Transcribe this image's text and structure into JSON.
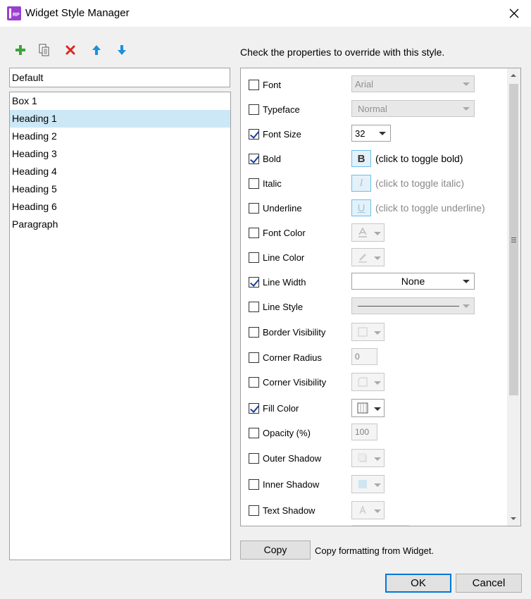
{
  "window": {
    "title": "Widget Style Manager",
    "app_icon_text": "RP"
  },
  "toolbar": {
    "add_icon": "plus-icon",
    "duplicate_icon": "duplicate-icon",
    "delete_icon": "delete-icon",
    "move_up_icon": "arrow-up-icon",
    "move_down_icon": "arrow-down-icon"
  },
  "style_name": "Default",
  "styles": [
    "Box 1",
    "Heading 1",
    "Heading 2",
    "Heading 3",
    "Heading 4",
    "Heading 5",
    "Heading 6",
    "Paragraph"
  ],
  "selected_style": "Heading 1",
  "instructions": "Check the properties to override with this style.",
  "properties": {
    "font": {
      "label": "Font",
      "checked": false,
      "value": "Arial"
    },
    "typeface": {
      "label": "Typeface",
      "checked": false,
      "value": "Normal"
    },
    "font_size": {
      "label": "Font Size",
      "checked": true,
      "value": "32"
    },
    "bold": {
      "label": "Bold",
      "checked": true,
      "glyph": "B",
      "hint": "(click to toggle bold)"
    },
    "italic": {
      "label": "Italic",
      "checked": false,
      "glyph": "I",
      "hint": "(click to toggle italic)"
    },
    "underline": {
      "label": "Underline",
      "checked": false,
      "glyph": "U",
      "hint": "(click to toggle underline)"
    },
    "font_color": {
      "label": "Font Color",
      "checked": false
    },
    "line_color": {
      "label": "Line Color",
      "checked": false
    },
    "line_width": {
      "label": "Line Width",
      "checked": true,
      "value": "None"
    },
    "line_style": {
      "label": "Line Style",
      "checked": false
    },
    "border_visibility": {
      "label": "Border Visibility",
      "checked": false
    },
    "corner_radius": {
      "label": "Corner Radius",
      "checked": false,
      "value": "0"
    },
    "corner_visibility": {
      "label": "Corner Visibility",
      "checked": false
    },
    "fill_color": {
      "label": "Fill Color",
      "checked": true
    },
    "opacity": {
      "label": "Opacity (%)",
      "checked": false,
      "value": "100"
    },
    "outer_shadow": {
      "label": "Outer Shadow",
      "checked": false
    },
    "inner_shadow": {
      "label": "Inner Shadow",
      "checked": false
    },
    "text_shadow": {
      "label": "Text Shadow",
      "checked": false
    }
  },
  "copy": {
    "button_label": "Copy",
    "description": "Copy formatting from Widget."
  },
  "buttons": {
    "ok": "OK",
    "cancel": "Cancel"
  },
  "colors": {
    "selection": "#cce8f6",
    "accent": "#0078d7",
    "brand": "#9a3fd0"
  }
}
